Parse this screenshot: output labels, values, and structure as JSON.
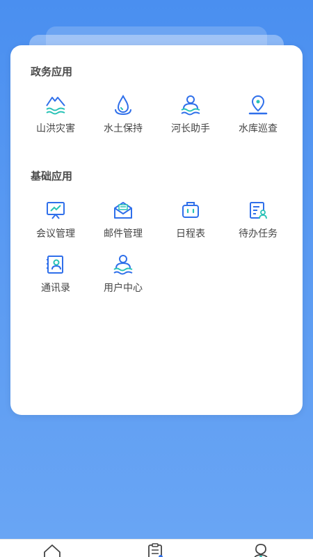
{
  "sections": [
    {
      "title": "政务应用",
      "items": [
        {
          "label": "山洪灾害",
          "icon": "mountain-flood-icon"
        },
        {
          "label": "水土保持",
          "icon": "water-drop-icon"
        },
        {
          "label": "河长助手",
          "icon": "river-chief-icon"
        },
        {
          "label": "水库巡查",
          "icon": "location-pin-icon"
        }
      ]
    },
    {
      "title": "基础应用",
      "items": [
        {
          "label": "会议管理",
          "icon": "presentation-board-icon"
        },
        {
          "label": "邮件管理",
          "icon": "mail-icon"
        },
        {
          "label": "日程表",
          "icon": "calendar-bag-icon"
        },
        {
          "label": "待办任务",
          "icon": "task-list-icon"
        },
        {
          "label": "通讯录",
          "icon": "contacts-icon"
        },
        {
          "label": "用户中心",
          "icon": "user-center-icon"
        }
      ]
    }
  ],
  "tabs": [
    {
      "icon": "home-icon"
    },
    {
      "icon": "clipboard-icon"
    },
    {
      "icon": "profile-icon"
    }
  ],
  "colors": {
    "primary": "#2f6fea",
    "teal": "#28c2b6",
    "background": "#5a9af2"
  }
}
